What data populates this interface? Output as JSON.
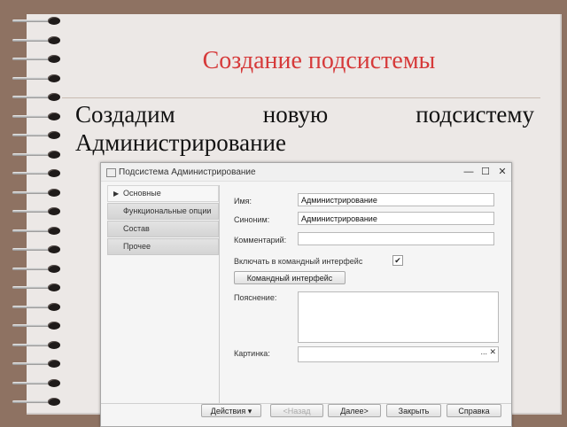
{
  "slide": {
    "title": "Создание подсистемы",
    "text": "Создадим новую подсистему Администрирование"
  },
  "dialog": {
    "title": "Подсистема Администрирование",
    "window_controls": {
      "minimize": "—",
      "maximize": "☐",
      "close": "✕"
    },
    "tabs": [
      {
        "label": "Основные",
        "active": true
      },
      {
        "label": "Функциональные опции",
        "active": false
      },
      {
        "label": "Состав",
        "active": false
      },
      {
        "label": "Прочее",
        "active": false
      }
    ],
    "fields": {
      "name_label": "Имя:",
      "name_value": "Администрирование",
      "synonym_label": "Синоним:",
      "synonym_value": "Администрирование",
      "comment_label": "Комментарий:",
      "comment_value": "",
      "include_label": "Включать в командный интерфейс",
      "include_checked": true,
      "include_check_glyph": "✔",
      "command_interface_button": "Командный интерфейс",
      "explanation_label": "Пояснение:",
      "picture_label": "Картинка:",
      "picture_buttons": "... ✕"
    },
    "footer": {
      "actions": "Действия ▾",
      "back": "<Назад",
      "next": "Далее>",
      "close": "Закрыть",
      "help": "Справка"
    }
  }
}
